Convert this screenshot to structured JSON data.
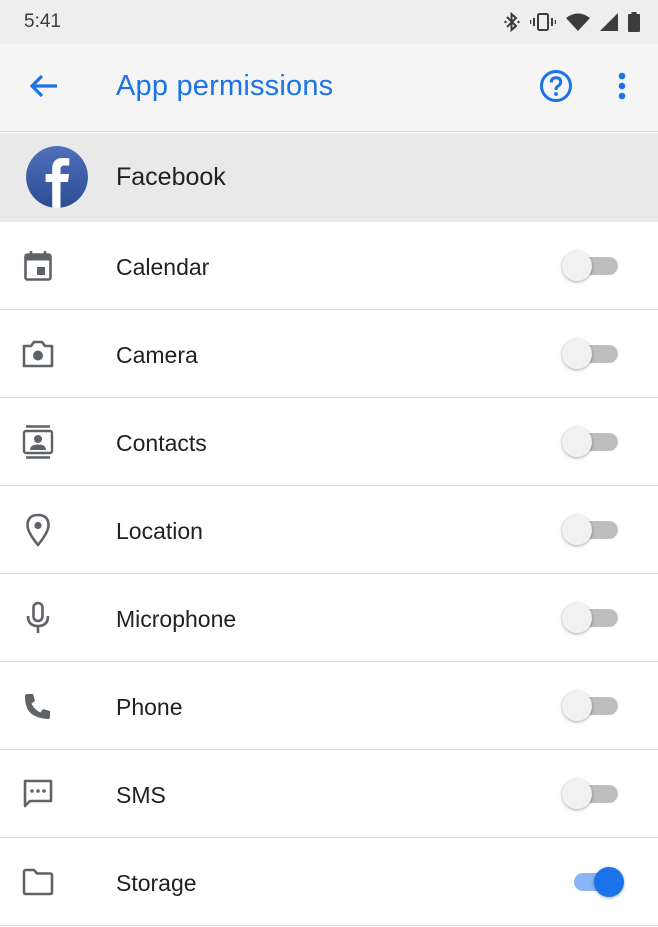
{
  "status_bar": {
    "time": "5:41",
    "icons": [
      "bluetooth-icon",
      "vibrate-icon",
      "wifi-icon",
      "signal-icon",
      "battery-icon"
    ]
  },
  "app_bar": {
    "title": "App permissions",
    "back_icon": "arrow-back-icon",
    "help_icon": "help-circle-icon",
    "more_icon": "more-vert-icon"
  },
  "app": {
    "name": "Facebook",
    "logo": "facebook-logo"
  },
  "colors": {
    "accent": "#1a73e8",
    "toggle_off_track": "#bdbdbd",
    "toggle_on_track": "#8ab4f8",
    "header_bg": "#e9e9e9",
    "app_bar_bg": "#f5f5f5",
    "status_bar_bg": "#eeeeee"
  },
  "permissions": [
    {
      "label": "Calendar",
      "icon": "calendar-icon",
      "enabled": false
    },
    {
      "label": "Camera",
      "icon": "camera-icon",
      "enabled": false
    },
    {
      "label": "Contacts",
      "icon": "contacts-icon",
      "enabled": false
    },
    {
      "label": "Location",
      "icon": "location-icon",
      "enabled": false
    },
    {
      "label": "Microphone",
      "icon": "microphone-icon",
      "enabled": false
    },
    {
      "label": "Phone",
      "icon": "phone-icon",
      "enabled": false
    },
    {
      "label": "SMS",
      "icon": "sms-icon",
      "enabled": false
    },
    {
      "label": "Storage",
      "icon": "folder-icon",
      "enabled": true
    }
  ]
}
